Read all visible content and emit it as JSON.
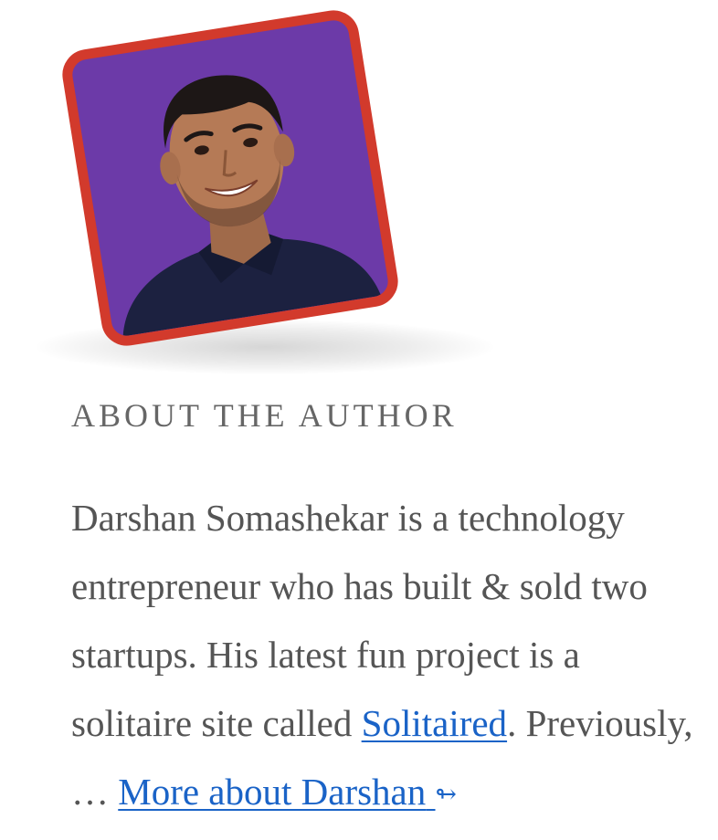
{
  "author": {
    "heading": "ABOUT THE AUTHOR",
    "bio_text_1": "Darshan Somashekar is a technology entrepreneur who has built & sold two startups. His latest fun project is a solitaire site called ",
    "link_label": "Solitaired",
    "bio_text_2": ". Previously, … ",
    "more_label": "More about Darshan",
    "more_icon": "↬"
  },
  "colors": {
    "frame": "#d23a2c",
    "photo_background": "#6c3aa8",
    "link": "#1a63c7",
    "heading": "#666666",
    "text": "#555555"
  },
  "icons": {
    "avatar": "author-photo",
    "more_arrow": "arrow-icon"
  }
}
